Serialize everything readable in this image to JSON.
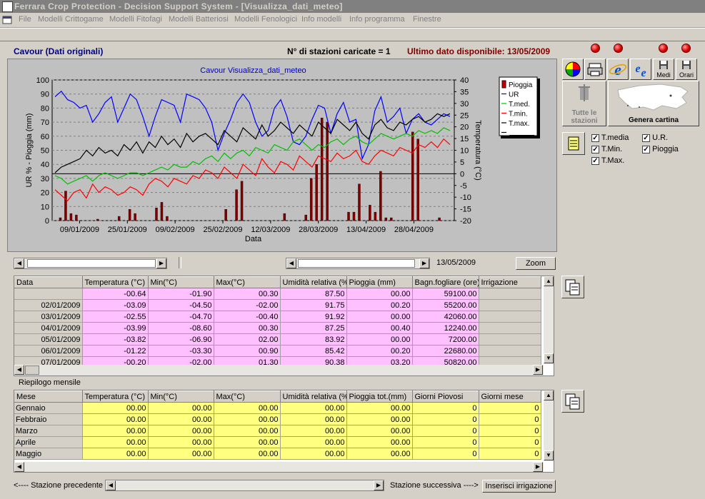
{
  "window": {
    "title": "Ferrara Crop Protection - Decision Support System - [Visualizza_dati_meteo]"
  },
  "menu": [
    "File",
    "Modelli Crittogame",
    "Modelli Fitofagi",
    "Modelli Batteriosi",
    "Modelli Fenologici",
    "Info modelli",
    "Info programma",
    "Finestre"
  ],
  "header": {
    "station": "Cavour (Dati originali)",
    "stations_loaded": "N° di stazioni caricate = 1",
    "last_data": "Ultimo dato disponibile: 13/05/2009"
  },
  "toolbar": {
    "medi": "Medi",
    "orari": "Orari",
    "all_stations": "Tutte le stazioni",
    "map": "Genera cartina"
  },
  "checkboxes": [
    {
      "label": "T.media",
      "checked": true
    },
    {
      "label": "U.R.",
      "checked": true
    },
    {
      "label": "T.Min.",
      "checked": true
    },
    {
      "label": "Pioggia",
      "checked": true
    },
    {
      "label": "T.Max.",
      "checked": true
    }
  ],
  "chart_data": {
    "type": "line",
    "title": "Cavour Visualizza_dati_meteo",
    "xlabel": "Data",
    "ylabel_left": "UR % - Pioggia (mm)",
    "ylabel_right": "Temperatura (°C)",
    "ylim_left": [
      0,
      100
    ],
    "ylim_right": [
      -20,
      40
    ],
    "yticks_left": [
      0,
      10,
      20,
      30,
      40,
      50,
      60,
      70,
      80,
      90,
      100
    ],
    "yticks_right": [
      -20,
      -15,
      -10,
      -5,
      0,
      5,
      10,
      15,
      20,
      25,
      30,
      35,
      40
    ],
    "xticks": [
      "09/01/2009",
      "25/01/2009",
      "09/02/2009",
      "25/02/2009",
      "12/03/2009",
      "28/03/2009",
      "13/04/2009",
      "28/04/2009"
    ],
    "legend": [
      "Pioggia",
      "UR",
      "T.med.",
      "T.min.",
      "T.max.",
      ""
    ],
    "legend_position": "right",
    "series": [
      {
        "name": "UR",
        "color": "#0000ff",
        "axis": "left",
        "values": [
          88,
          92,
          86,
          84,
          80,
          82,
          70,
          76,
          84,
          88,
          70,
          80,
          90,
          86,
          74,
          60,
          74,
          86,
          84,
          82,
          70,
          90,
          88,
          86,
          80,
          70,
          50,
          62,
          72,
          84,
          90,
          84,
          70,
          60,
          64,
          80,
          86,
          74,
          56,
          54,
          60,
          72,
          82,
          80,
          62,
          76,
          84,
          70,
          72,
          44,
          54,
          78,
          88,
          70,
          74,
          80,
          62,
          72,
          76,
          70,
          68,
          72,
          76,
          74
        ]
      },
      {
        "name": "T.med.",
        "color": "#00c000",
        "axis": "left",
        "values": [
          32,
          30,
          26,
          28,
          30,
          32,
          28,
          32,
          34,
          32,
          30,
          32,
          34,
          34,
          32,
          34,
          36,
          38,
          36,
          40,
          38,
          38,
          42,
          40,
          44,
          46,
          42,
          48,
          44,
          48,
          50,
          46,
          52,
          50,
          48,
          54,
          52,
          50,
          56,
          58,
          54,
          50,
          54,
          52,
          56,
          58,
          54,
          58,
          60,
          56,
          54,
          58,
          62,
          60,
          58,
          60,
          62,
          60,
          64,
          62,
          64,
          62,
          66,
          64
        ]
      },
      {
        "name": "T.min.",
        "color": "#ff0000",
        "axis": "left",
        "values": [
          22,
          18,
          14,
          20,
          22,
          16,
          26,
          20,
          24,
          22,
          18,
          20,
          24,
          22,
          18,
          26,
          30,
          28,
          24,
          30,
          28,
          26,
          32,
          30,
          36,
          34,
          30,
          38,
          34,
          30,
          40,
          36,
          32,
          44,
          38,
          34,
          42,
          40,
          36,
          46,
          42,
          38,
          46,
          44,
          42,
          48,
          44,
          46,
          50,
          42,
          40,
          46,
          50,
          48,
          46,
          52,
          50,
          48,
          54,
          52,
          56,
          52,
          58,
          54
        ]
      },
      {
        "name": "T.max.",
        "color": "#000000",
        "axis": "left",
        "values": [
          34,
          38,
          40,
          42,
          44,
          50,
          46,
          52,
          48,
          50,
          46,
          54,
          50,
          56,
          48,
          56,
          52,
          60,
          54,
          58,
          52,
          62,
          56,
          60,
          62,
          58,
          54,
          64,
          60,
          56,
          66,
          62,
          58,
          68,
          60,
          64,
          70,
          66,
          62,
          68,
          64,
          60,
          70,
          66,
          62,
          72,
          68,
          64,
          70,
          62,
          58,
          68,
          72,
          66,
          64,
          70,
          68,
          72,
          74,
          70,
          72,
          76,
          74,
          76
        ]
      },
      {
        "name": "Pioggia",
        "color": "#800000",
        "axis": "left",
        "type": "bar",
        "values": [
          0,
          2,
          21,
          5,
          4,
          0,
          0,
          0,
          1,
          0,
          0,
          0,
          3,
          0,
          8,
          5,
          0,
          0,
          0,
          9,
          13,
          3,
          0,
          0,
          0,
          0,
          0,
          0,
          0,
          0,
          0,
          0,
          8,
          0,
          22,
          28,
          0,
          0,
          0,
          0,
          0,
          0,
          0,
          5,
          0,
          0,
          0,
          4,
          30,
          40,
          73,
          70,
          0,
          0,
          0,
          6,
          6,
          26,
          0,
          11,
          6,
          35,
          2,
          2,
          0,
          0,
          0,
          63,
          58,
          0,
          0,
          0,
          2,
          0,
          0
        ]
      }
    ]
  },
  "scrollbars": {
    "date_label": "13/05/2009",
    "zoom": "Zoom"
  },
  "daily_table": {
    "headers": [
      "Data",
      "Temperatura (°C)",
      "Min(°C)",
      "Max(°C)",
      "Umidità relativa (%",
      "Pioggia (mm)",
      "Bagn.fogliare (ore)",
      "Irrigazione"
    ],
    "rows": [
      [
        "",
        "-00.64",
        "-01.90",
        "00.30",
        "87.50",
        "00.00",
        "59100.00",
        ""
      ],
      [
        "02/01/2009",
        "-03.09",
        "-04.50",
        "-02.00",
        "91.75",
        "00.20",
        "55200.00",
        ""
      ],
      [
        "03/01/2009",
        "-02.55",
        "-04.70",
        "-00.40",
        "91.92",
        "00.00",
        "42060.00",
        ""
      ],
      [
        "04/01/2009",
        "-03.99",
        "-08.60",
        "00.30",
        "87.25",
        "00.40",
        "12240.00",
        ""
      ],
      [
        "05/01/2009",
        "-03.82",
        "-06.90",
        "02.00",
        "83.92",
        "00.00",
        "7200.00",
        ""
      ],
      [
        "06/01/2009",
        "-01.22",
        "-03.30",
        "00.90",
        "85.42",
        "00.20",
        "22680.00",
        ""
      ],
      [
        "07/01/2009",
        "-00.20",
        "-02.00",
        "01.30",
        "90.38",
        "03.20",
        "50820.00",
        ""
      ]
    ]
  },
  "monthly_label": "Riepilogo mensile",
  "monthly_table": {
    "headers": [
      "Mese",
      "Temperatura (°C)",
      "Min(°C)",
      "Max(°C)",
      "Umidità relativa (%",
      "Pioggia tot.(mm)",
      "Giorni Piovosi",
      "Giorni mese"
    ],
    "rows": [
      [
        "Gennaio",
        "00.00",
        "00.00",
        "00.00",
        "00.00",
        "00.00",
        "0",
        "0"
      ],
      [
        "Febbraio",
        "00.00",
        "00.00",
        "00.00",
        "00.00",
        "00.00",
        "0",
        "0"
      ],
      [
        "Marzo",
        "00.00",
        "00.00",
        "00.00",
        "00.00",
        "00.00",
        "0",
        "0"
      ],
      [
        "Aprile",
        "00.00",
        "00.00",
        "00.00",
        "00.00",
        "00.00",
        "0",
        "0"
      ],
      [
        "Maggio",
        "00.00",
        "00.00",
        "00.00",
        "00.00",
        "00.00",
        "0",
        "0"
      ]
    ]
  },
  "footer": {
    "prev": "<---- Stazione precedente",
    "next": "Stazione successiva ---->",
    "insert": "Inserisci irrigazione"
  }
}
